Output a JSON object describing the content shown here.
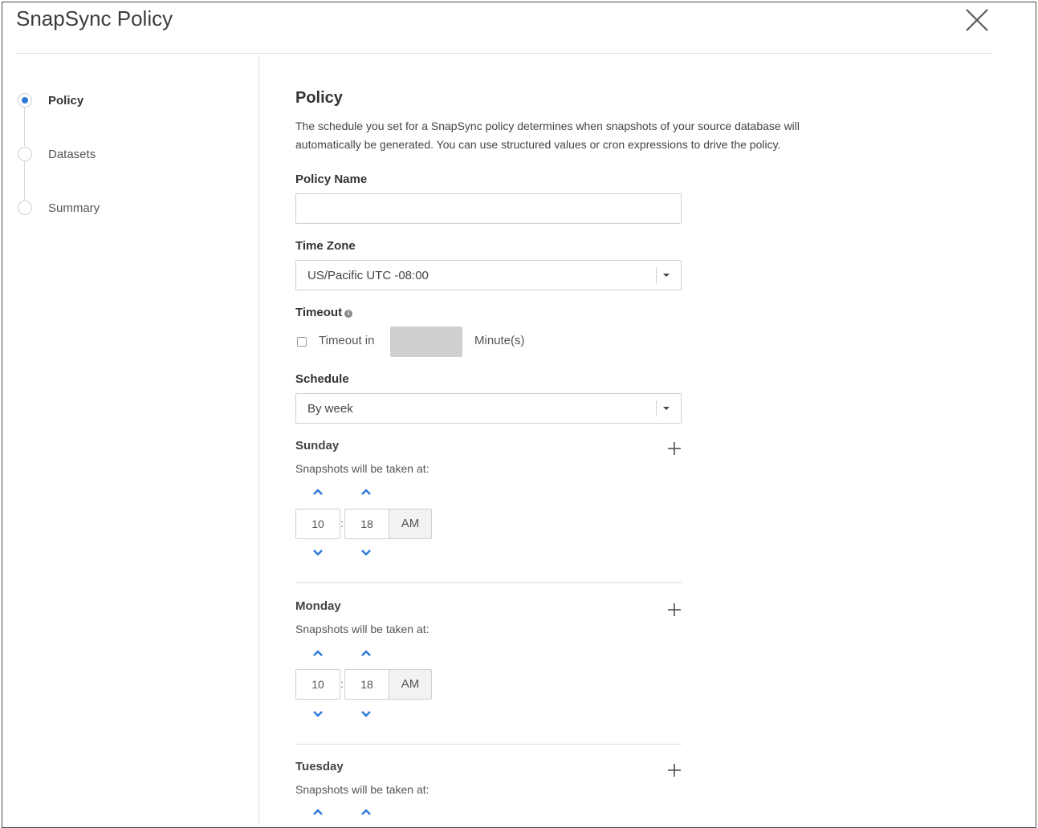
{
  "header": {
    "title": "SnapSync Policy"
  },
  "steps": [
    {
      "label": "Policy",
      "active": true
    },
    {
      "label": "Datasets",
      "active": false
    },
    {
      "label": "Summary",
      "active": false
    }
  ],
  "policy": {
    "heading": "Policy",
    "description_line1": "The schedule you set for a SnapSync policy determines when snapshots of your source database will",
    "description_line2": "automatically be generated. You can use structured values or cron expressions to drive the policy.",
    "policy_name_label": "Policy Name",
    "policy_name_value": "",
    "time_zone_label": "Time Zone",
    "time_zone_value": "US/Pacific UTC -08:00",
    "timeout_label": "Timeout",
    "timeout_checkbox_label": "Timeout in",
    "timeout_unit": "Minute(s)",
    "schedule_label": "Schedule",
    "schedule_value": "By week"
  },
  "days": [
    {
      "name": "Sunday",
      "snap_text": "Snapshots will be taken at:",
      "hour": "10",
      "minute": "18",
      "ampm": "AM"
    },
    {
      "name": "Monday",
      "snap_text": "Snapshots will be taken at:",
      "hour": "10",
      "minute": "18",
      "ampm": "AM"
    },
    {
      "name": "Tuesday",
      "snap_text": "Snapshots will be taken at:"
    }
  ],
  "colors": {
    "accent": "#2f79d8",
    "border": "#cfcfcf",
    "text": "#333333"
  },
  "icons": {
    "close": "close-icon",
    "add": "plus-icon",
    "up": "chevron-up-icon",
    "down": "chevron-down-icon",
    "info": "info-icon"
  }
}
